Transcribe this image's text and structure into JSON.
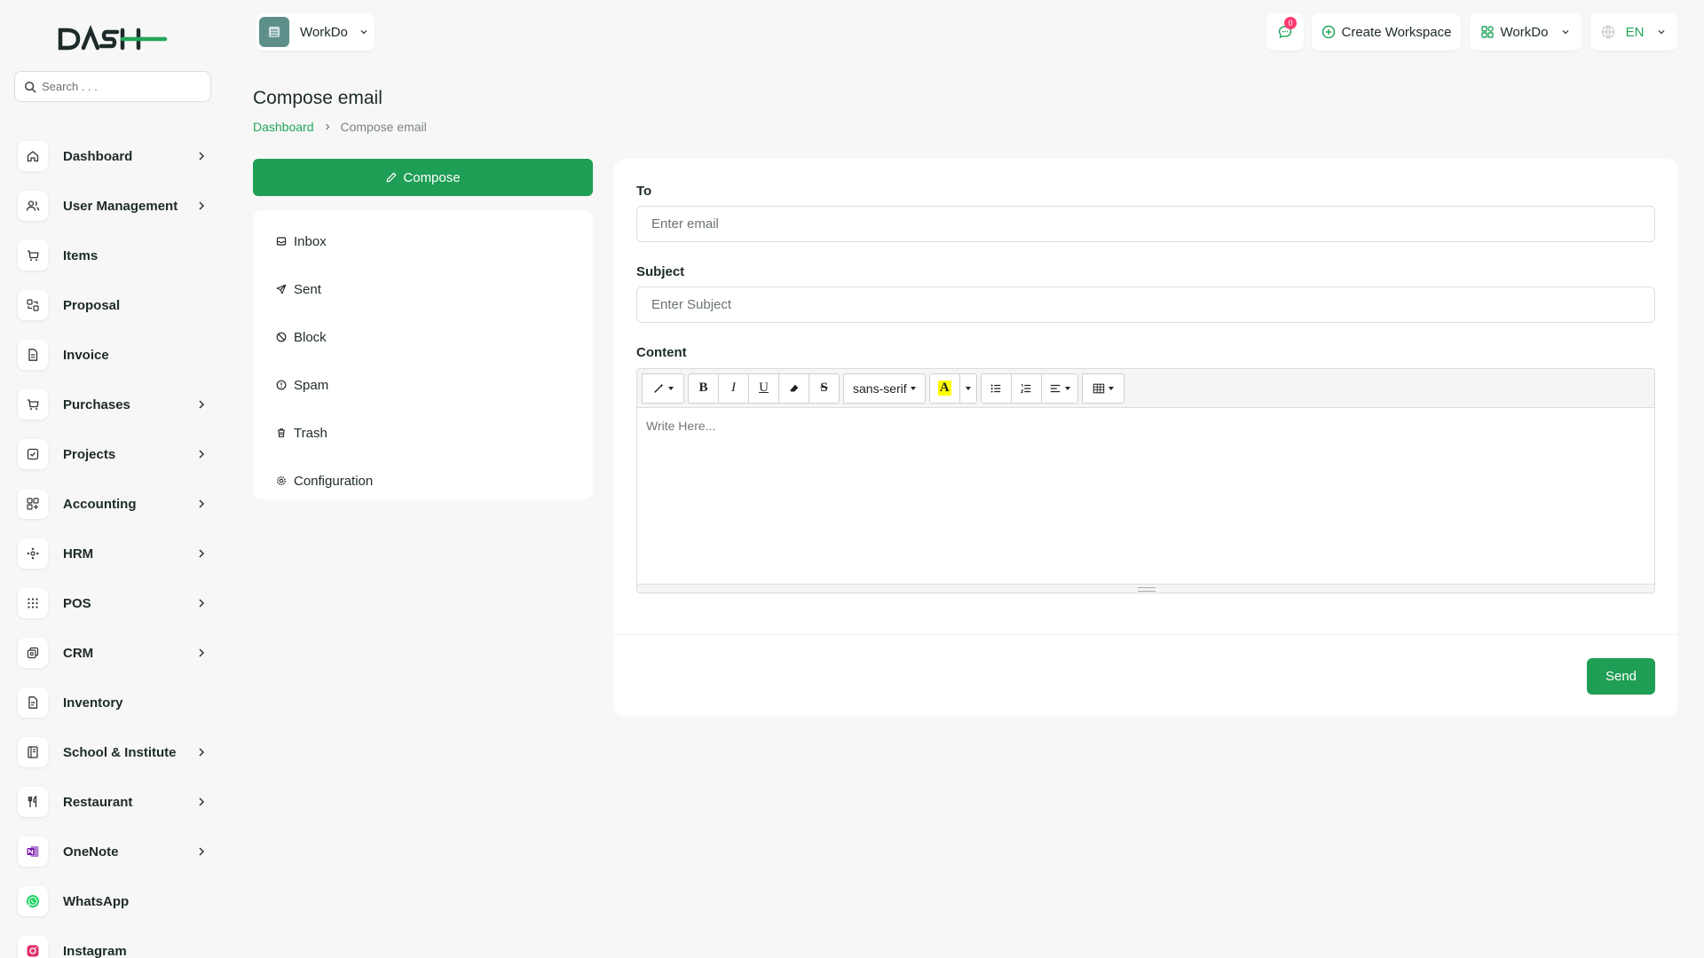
{
  "brand": {
    "logo_text": "DASH",
    "accent": "#1f9e55"
  },
  "search": {
    "placeholder": "Search . . ."
  },
  "sidebar": {
    "items": [
      {
        "label": "Dashboard",
        "icon": "home-icon",
        "chevron": true
      },
      {
        "label": "User Management",
        "icon": "users-icon",
        "chevron": true
      },
      {
        "label": "Items",
        "icon": "cart-icon",
        "chevron": false
      },
      {
        "label": "Proposal",
        "icon": "proposal-icon",
        "chevron": false
      },
      {
        "label": "Invoice",
        "icon": "invoice-icon",
        "chevron": false
      },
      {
        "label": "Purchases",
        "icon": "cart-icon",
        "chevron": true
      },
      {
        "label": "Projects",
        "icon": "check-square-icon",
        "chevron": true
      },
      {
        "label": "Accounting",
        "icon": "grid-icon",
        "chevron": true
      },
      {
        "label": "HRM",
        "icon": "hrm-icon",
        "chevron": true
      },
      {
        "label": "POS",
        "icon": "dots-grid-icon",
        "chevron": true
      },
      {
        "label": "CRM",
        "icon": "crm-icon",
        "chevron": true
      },
      {
        "label": "Inventory",
        "icon": "document-icon",
        "chevron": false
      },
      {
        "label": "School & Institute",
        "icon": "book-icon",
        "chevron": true
      },
      {
        "label": "Restaurant",
        "icon": "utensils-icon",
        "chevron": true
      },
      {
        "label": "OneNote",
        "icon": "onenote-icon",
        "chevron": true
      },
      {
        "label": "WhatsApp",
        "icon": "whatsapp-icon",
        "chevron": false
      },
      {
        "label": "Instagram",
        "icon": "instagram-icon",
        "chevron": false
      }
    ]
  },
  "header": {
    "workspace_name": "WorkDo",
    "notification_count": "0",
    "create_workspace": "Create Workspace",
    "workspace_switch": "WorkDo",
    "language": "EN"
  },
  "page": {
    "title": "Compose email",
    "breadcrumb": {
      "home": "Dashboard",
      "current": "Compose email"
    }
  },
  "mailbox": {
    "compose_label": "Compose",
    "folders": [
      {
        "label": "Inbox",
        "icon": "inbox-icon"
      },
      {
        "label": "Sent",
        "icon": "send-icon"
      },
      {
        "label": "Block",
        "icon": "block-icon"
      },
      {
        "label": "Spam",
        "icon": "spam-icon"
      },
      {
        "label": "Trash",
        "icon": "trash-icon"
      },
      {
        "label": "Configuration",
        "icon": "gear-icon"
      }
    ]
  },
  "form": {
    "to_label": "To",
    "to_placeholder": "Enter email",
    "to_value": "",
    "subject_label": "Subject",
    "subject_placeholder": "Enter Subject",
    "subject_value": "",
    "content_label": "Content",
    "content_placeholder": "Write Here...",
    "font_family": "sans-serif",
    "send_label": "Send"
  }
}
